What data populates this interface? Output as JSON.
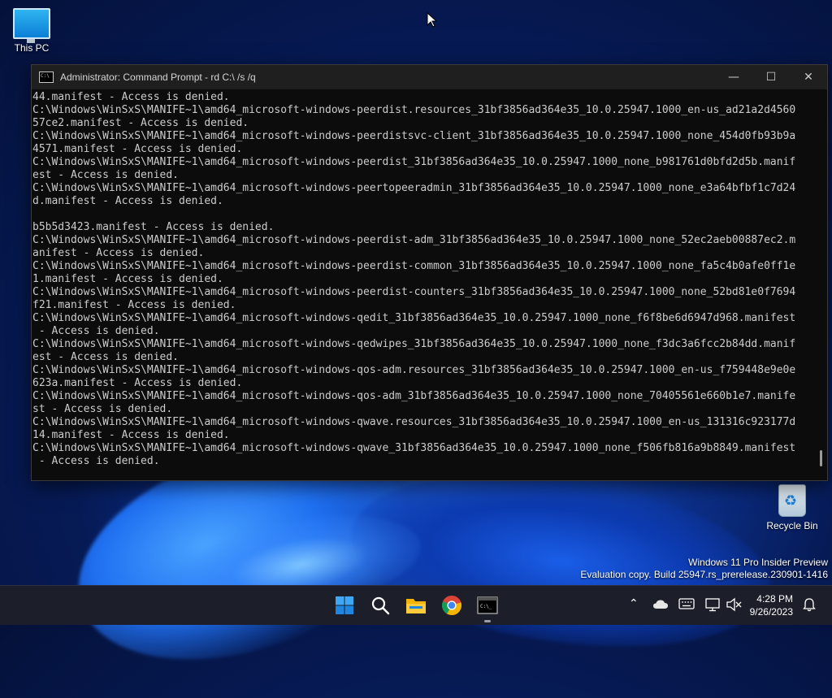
{
  "desktop": {
    "this_pc_label": "This PC",
    "recycle_bin_label": "Recycle Bin"
  },
  "window": {
    "title": "Administrator: Command Prompt - rd  C:\\ /s /q",
    "controls": {
      "minimize": "—",
      "maximize": "☐",
      "close": "✕"
    }
  },
  "console_lines": [
    "44.manifest - Access is denied.",
    "C:\\Windows\\WinSxS\\MANIFE~1\\amd64_microsoft-windows-peerdist.resources_31bf3856ad364e35_10.0.25947.1000_en-us_ad21a2d4560",
    "57ce2.manifest - Access is denied.",
    "C:\\Windows\\WinSxS\\MANIFE~1\\amd64_microsoft-windows-peerdistsvc-client_31bf3856ad364e35_10.0.25947.1000_none_454d0fb93b9a",
    "4571.manifest - Access is denied.",
    "C:\\Windows\\WinSxS\\MANIFE~1\\amd64_microsoft-windows-peerdist_31bf3856ad364e35_10.0.25947.1000_none_b981761d0bfd2d5b.manif",
    "est - Access is denied.",
    "C:\\Windows\\WinSxS\\MANIFE~1\\amd64_microsoft-windows-peertopeeradmin_31bf3856ad364e35_10.0.25947.1000_none_e3a64bfbf1c7d24",
    "d.manifest - Access is denied.",
    "",
    "b5b5d3423.manifest - Access is denied.",
    "C:\\Windows\\WinSxS\\MANIFE~1\\amd64_microsoft-windows-peerdist-adm_31bf3856ad364e35_10.0.25947.1000_none_52ec2aeb00887ec2.m",
    "anifest - Access is denied.",
    "C:\\Windows\\WinSxS\\MANIFE~1\\amd64_microsoft-windows-peerdist-common_31bf3856ad364e35_10.0.25947.1000_none_fa5c4b0afe0ff1e",
    "1.manifest - Access is denied.",
    "C:\\Windows\\WinSxS\\MANIFE~1\\amd64_microsoft-windows-peerdist-counters_31bf3856ad364e35_10.0.25947.1000_none_52bd81e0f7694",
    "f21.manifest - Access is denied.",
    "C:\\Windows\\WinSxS\\MANIFE~1\\amd64_microsoft-windows-qedit_31bf3856ad364e35_10.0.25947.1000_none_f6f8be6d6947d968.manifest",
    " - Access is denied.",
    "C:\\Windows\\WinSxS\\MANIFE~1\\amd64_microsoft-windows-qedwipes_31bf3856ad364e35_10.0.25947.1000_none_f3dc3a6fcc2b84dd.manif",
    "est - Access is denied.",
    "C:\\Windows\\WinSxS\\MANIFE~1\\amd64_microsoft-windows-qos-adm.resources_31bf3856ad364e35_10.0.25947.1000_en-us_f759448e9e0e",
    "623a.manifest - Access is denied.",
    "C:\\Windows\\WinSxS\\MANIFE~1\\amd64_microsoft-windows-qos-adm_31bf3856ad364e35_10.0.25947.1000_none_70405561e660b1e7.manife",
    "st - Access is denied.",
    "C:\\Windows\\WinSxS\\MANIFE~1\\amd64_microsoft-windows-qwave.resources_31bf3856ad364e35_10.0.25947.1000_en-us_131316c923177d",
    "14.manifest - Access is denied.",
    "C:\\Windows\\WinSxS\\MANIFE~1\\amd64_microsoft-windows-qwave_31bf3856ad364e35_10.0.25947.1000_none_f506fb816a9b8849.manifest",
    " - Access is denied."
  ],
  "watermark": {
    "line1": "Windows 11 Pro Insider Preview",
    "line2": "Evaluation copy. Build 25947.rs_prerelease.230901-1416"
  },
  "taskbar": {
    "icons": [
      "windows-start-icon",
      "search-icon",
      "file-explorer-icon",
      "chrome-icon",
      "command-prompt-icon"
    ],
    "tray_icons": [
      "chevron-up-icon",
      "onedrive-icon",
      "keyboard-icon",
      "network-icon",
      "volume-muted-icon",
      "notification-bell-icon"
    ],
    "clock_time": "4:28 PM",
    "clock_date": "9/26/2023"
  },
  "colors": {
    "console_bg": "#0c0c0c",
    "console_text": "#cccccc",
    "titlebar_bg": "#1f1f1f",
    "taskbar_bg": "#1c1f2a"
  }
}
